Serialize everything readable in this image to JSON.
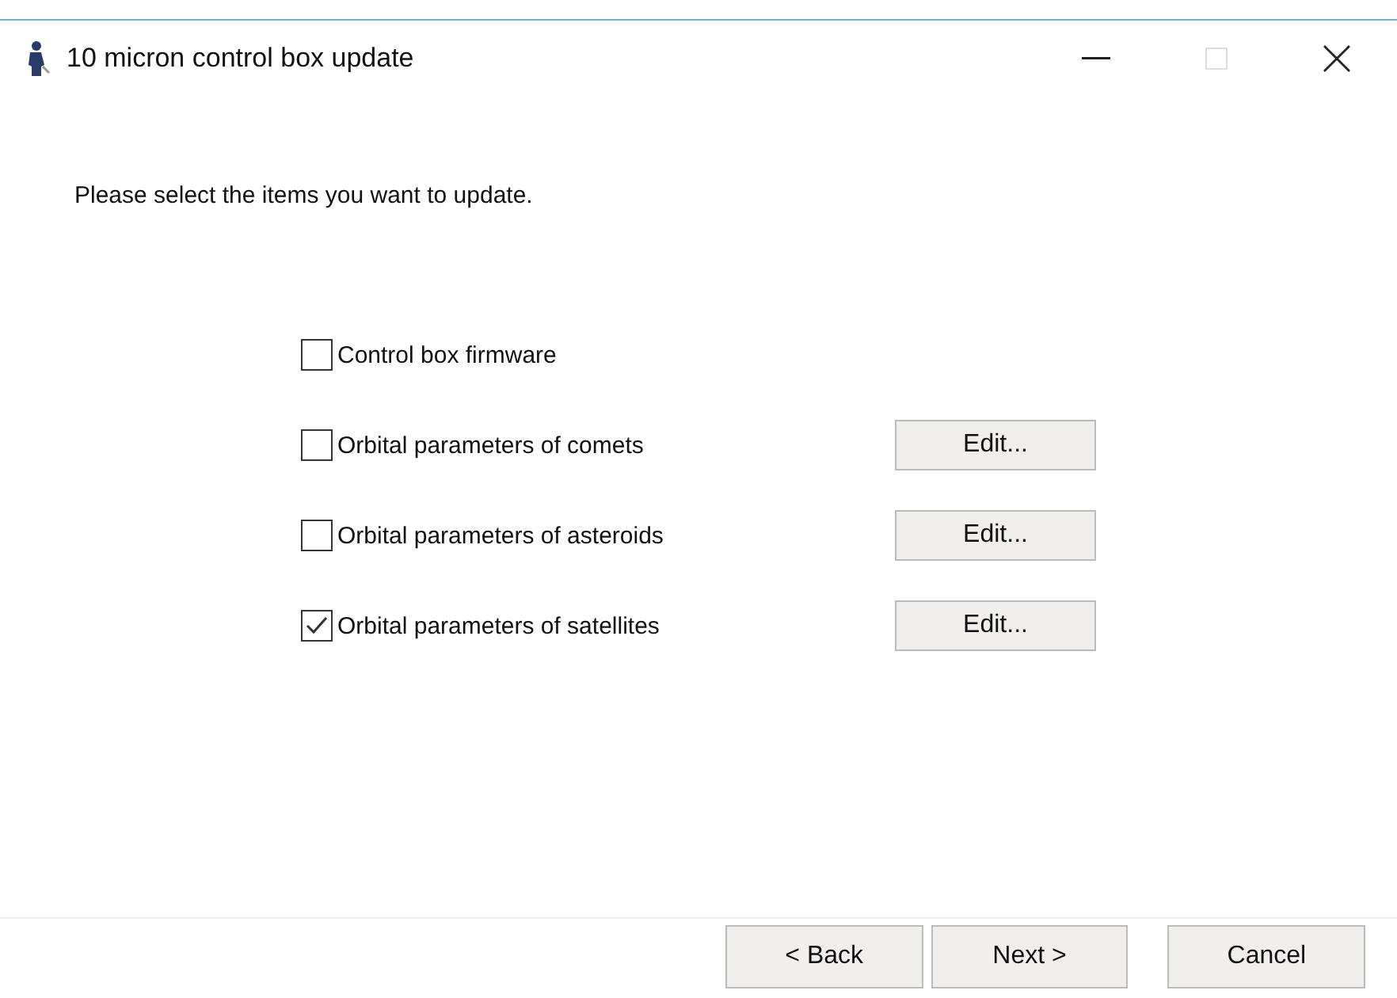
{
  "window": {
    "title": "10 micron control box update"
  },
  "prompt": "Please select the items you want to update.",
  "items": [
    {
      "label": "Control box firmware",
      "checked": false
    },
    {
      "label": "Orbital parameters of comets",
      "checked": false,
      "edit_button": "Edit..."
    },
    {
      "label": "Orbital parameters of asteroids",
      "checked": false,
      "edit_button": "Edit..."
    },
    {
      "label": "Orbital parameters of satellites",
      "checked": true,
      "edit_button": "Edit..."
    }
  ],
  "buttons": [
    {
      "label": "< Back",
      "kind": "nav"
    },
    {
      "label": "Next >",
      "kind": "nav"
    },
    {
      "label": "Cancel",
      "kind": "cancel"
    }
  ]
}
